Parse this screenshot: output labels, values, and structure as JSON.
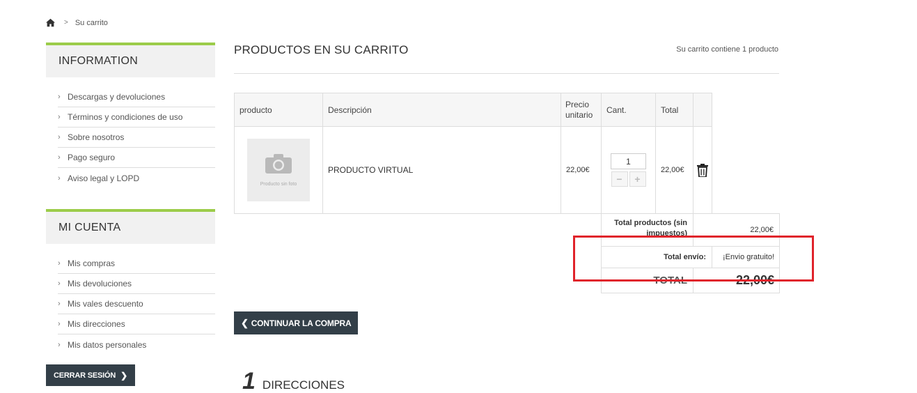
{
  "breadcrumb": {
    "home_icon": "home-icon",
    "separator": ">",
    "current": "Su carrito"
  },
  "sidebar": {
    "information": {
      "title": "INFORMATION",
      "items": [
        {
          "label": "Descargas y devoluciones"
        },
        {
          "label": "Términos y condiciones de uso"
        },
        {
          "label": "Sobre nosotros"
        },
        {
          "label": "Pago seguro"
        },
        {
          "label": "Aviso legal y LOPD"
        }
      ]
    },
    "account": {
      "title": "MI CUENTA",
      "items": [
        {
          "label": "Mis compras"
        },
        {
          "label": "Mis devoluciones"
        },
        {
          "label": "Mis vales descuento"
        },
        {
          "label": "Mis direcciones"
        },
        {
          "label": "Mis datos personales"
        }
      ]
    },
    "logout_label": "CERRAR SESIÓN"
  },
  "cart": {
    "heading": "PRODUCTOS EN SU CARRITO",
    "count_text": "Su carrito contiene 1 producto",
    "columns": {
      "product": "producto",
      "description": "Descripción",
      "unit_price": "Precio unitario",
      "qty": "Cant.",
      "total": "Total"
    },
    "items": [
      {
        "image_caption": "Producto sin foto",
        "name": "PRODUCTO VIRTUAL",
        "unit_price": "22,00€",
        "qty": "1",
        "total": "22,00€"
      }
    ],
    "totals": {
      "products_label": "Total productos (sin impuestos)",
      "products_value": "22,00€",
      "shipping_label": "Total envío:",
      "shipping_value": "¡Envio gratuito!",
      "total_label": "TOTAL",
      "total_value": "22,00€"
    },
    "continue_label": "CONTINUAR LA COMPRA"
  },
  "step": {
    "number": "1",
    "title": "DIRECCIONES"
  },
  "colors": {
    "accent_green": "#9ccc4a",
    "dark_button": "#333f48",
    "highlight_red": "#e0232b"
  }
}
